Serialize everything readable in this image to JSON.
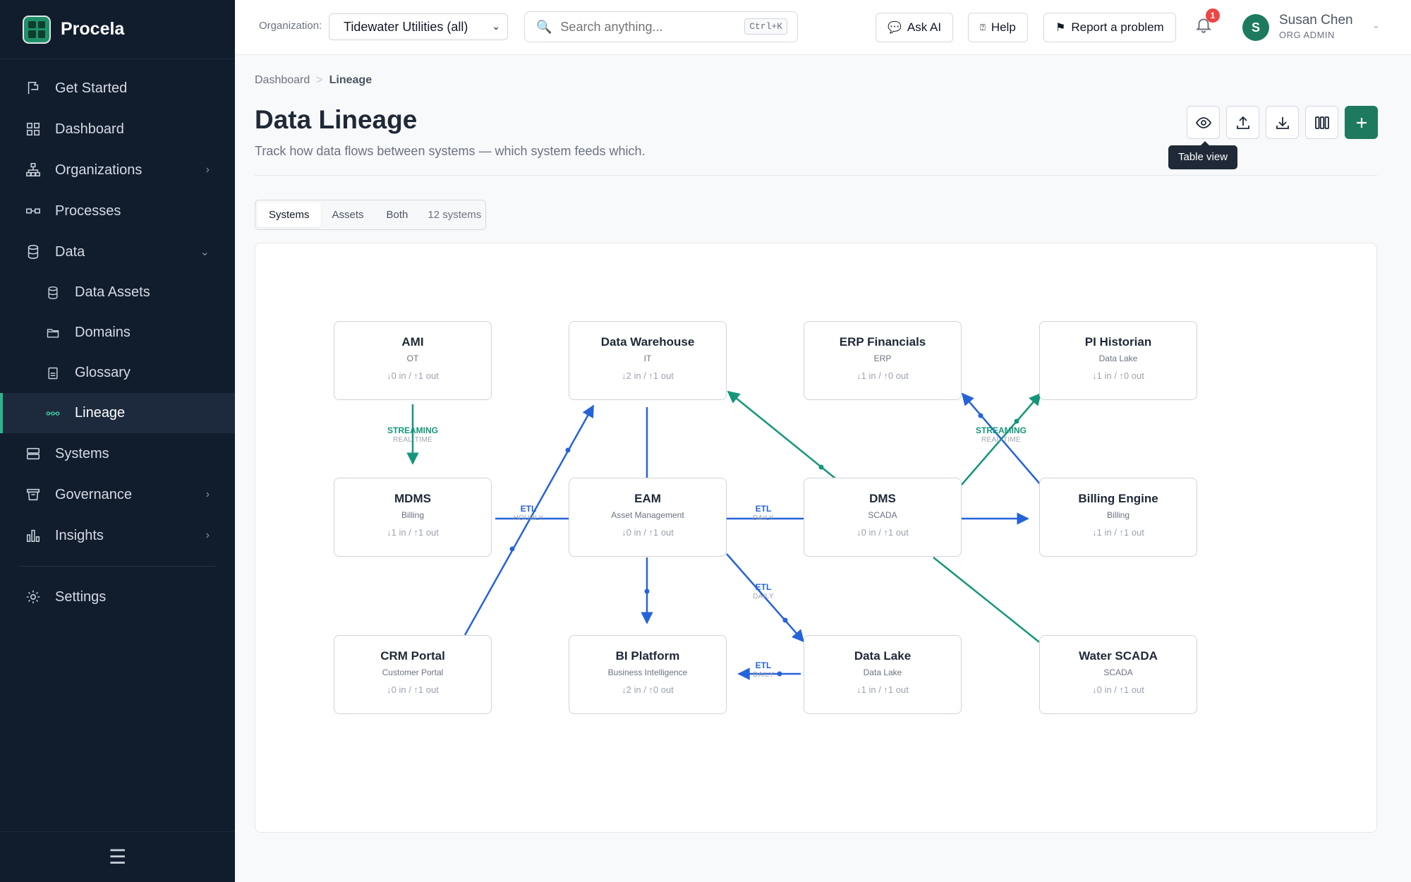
{
  "app": {
    "name": "Procela"
  },
  "sidebar": {
    "items": [
      {
        "label": "Get Started",
        "icon": "flag-icon"
      },
      {
        "label": "Dashboard",
        "icon": "grid-icon"
      },
      {
        "label": "Organizations",
        "icon": "org-chart-icon"
      },
      {
        "label": "Processes",
        "icon": "process-icon"
      },
      {
        "label": "Data",
        "icon": "database-icon"
      },
      {
        "label": "Data Assets",
        "icon": "database-icon"
      },
      {
        "label": "Domains",
        "icon": "folder-icon"
      },
      {
        "label": "Glossary",
        "icon": "book-icon"
      },
      {
        "label": "Lineage",
        "icon": "lineage-icon",
        "active": true
      },
      {
        "label": "Systems",
        "icon": "server-icon"
      },
      {
        "label": "Governance",
        "icon": "governance-icon"
      },
      {
        "label": "Insights",
        "icon": "bar-chart-icon"
      },
      {
        "label": "Settings",
        "icon": "gear-icon"
      }
    ],
    "footer_icon": "☰"
  },
  "topbar": {
    "org_label": "Organization:",
    "org_value": "Tidewater Utilities (all)",
    "search_placeholder": "Search anything...",
    "search_shortcut": "Ctrl+K",
    "ask_ai": "Ask AI",
    "help": "Help",
    "report": "Report a problem",
    "notification_count": "1",
    "user_initial": "S",
    "user_name": "Susan Chen",
    "user_role": "ORG ADMIN"
  },
  "page": {
    "breadcrumb": [
      "Dashboard",
      "Lineage"
    ],
    "title": "Data Lineage",
    "subtitle": "Track how data flows between systems — which system feeds which.",
    "tooltip": "Table view",
    "tabs": [
      "Systems",
      "Assets",
      "Both"
    ],
    "active_tab": "Systems",
    "count": "12 systems"
  },
  "colors": {
    "accent": "#1d7a5e",
    "etl": "#2563d9",
    "streaming": "#15967a",
    "sidebar": "#111c2d"
  },
  "nodes": [
    {
      "id": "ami",
      "title": "AMI",
      "sub": "OT",
      "counts": "↓0 in / ↑1 out"
    },
    {
      "id": "dw",
      "title": "Data Warehouse",
      "sub": "IT",
      "counts": "↓2 in / ↑1 out"
    },
    {
      "id": "erp",
      "title": "ERP Financials",
      "sub": "ERP",
      "counts": "↓1 in / ↑0 out"
    },
    {
      "id": "pi",
      "title": "PI Historian",
      "sub": "Data Lake",
      "counts": "↓1 in / ↑0 out"
    },
    {
      "id": "mdms",
      "title": "MDMS",
      "sub": "Billing",
      "counts": "↓1 in / ↑1 out"
    },
    {
      "id": "eam",
      "title": "EAM",
      "sub": "Asset Management",
      "counts": "↓0 in / ↑1 out"
    },
    {
      "id": "dms",
      "title": "DMS",
      "sub": "SCADA",
      "counts": "↓0 in / ↑1 out"
    },
    {
      "id": "billing",
      "title": "Billing Engine",
      "sub": "Billing",
      "counts": "↓1 in / ↑1 out"
    },
    {
      "id": "crm",
      "title": "CRM Portal",
      "sub": "Customer Portal",
      "counts": "↓0 in / ↑1 out"
    },
    {
      "id": "bi",
      "title": "BI Platform",
      "sub": "Business Intelligence",
      "counts": "↓2 in / ↑0 out"
    },
    {
      "id": "lake",
      "title": "Data Lake",
      "sub": "Data Lake",
      "counts": "↓1 in / ↑1 out"
    },
    {
      "id": "wscada",
      "title": "Water SCADA",
      "sub": "SCADA",
      "counts": "↓0 in / ↑1 out"
    }
  ],
  "edge_labels": [
    {
      "type": "STREAMING",
      "freq": "REAL-TIME"
    },
    {
      "type": "ETL",
      "freq": "HOURLY"
    },
    {
      "type": "ETL",
      "freq": "DAILY"
    },
    {
      "type": "STREAMING",
      "freq": "REAL-TIME"
    },
    {
      "type": "ETL",
      "freq": "DAILY"
    },
    {
      "type": "ETL",
      "freq": "DAILY"
    }
  ]
}
